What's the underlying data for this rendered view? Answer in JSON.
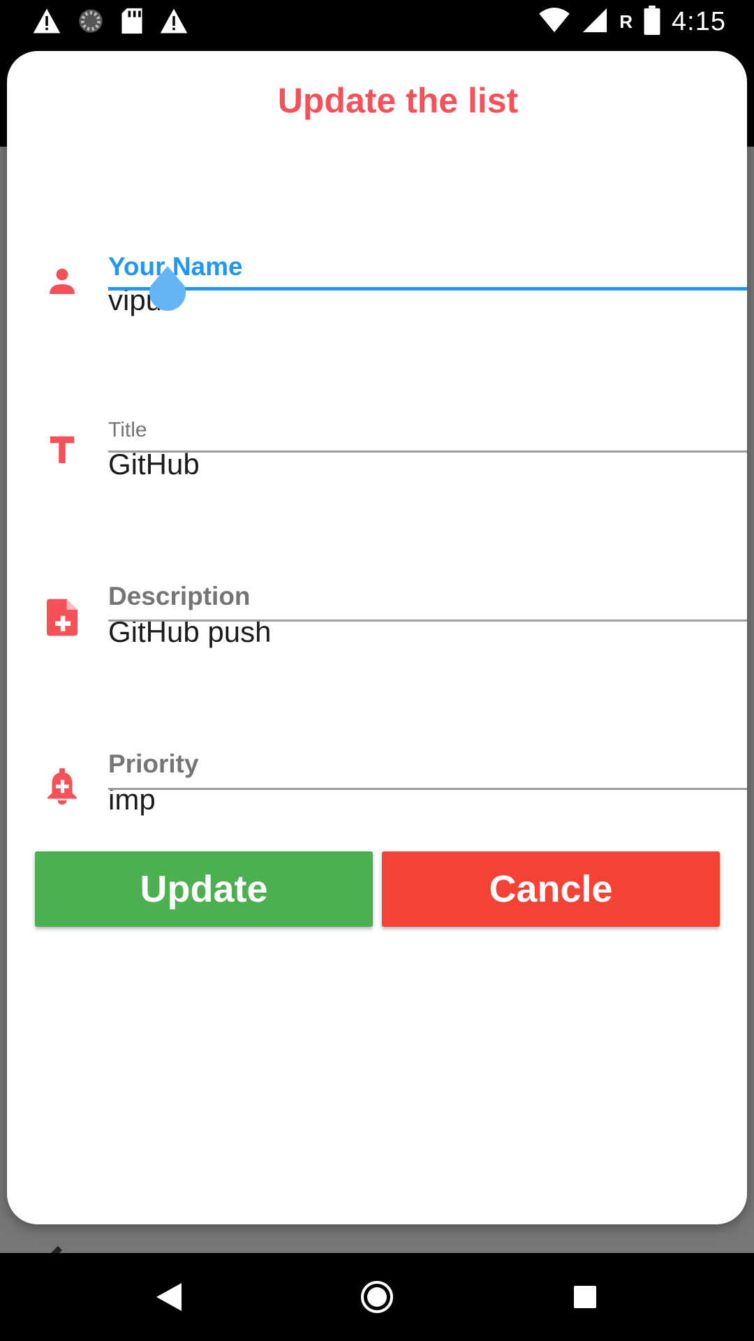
{
  "status_bar": {
    "time": "4:15",
    "network_letter": "R",
    "icons": [
      "warning-icon",
      "loading-icon",
      "sd-card-icon",
      "warning-icon",
      "wifi-icon",
      "signal-icon",
      "battery-icon"
    ]
  },
  "dialog": {
    "title": "Update the list",
    "fields": {
      "name": {
        "label": "Your Name",
        "value": "vipul",
        "icon": "person-icon"
      },
      "title": {
        "label": "Title",
        "value": "GitHub",
        "icon": "title-text-icon"
      },
      "description": {
        "label": "Description",
        "value": "GitHub push",
        "icon": "note-add-icon"
      },
      "priority": {
        "label": "Priority",
        "value": "imp",
        "icon": "alarm-add-icon"
      }
    },
    "buttons": {
      "update_label": "Update",
      "cancel_label": "Cancle"
    }
  },
  "colors": {
    "accent_red": "#f65058",
    "focus_blue": "#2196f3",
    "update_green": "#4caf50",
    "cancel_red": "#f44336"
  },
  "nav_bar": {
    "icons": [
      "back-icon",
      "home-icon",
      "recents-icon"
    ]
  }
}
